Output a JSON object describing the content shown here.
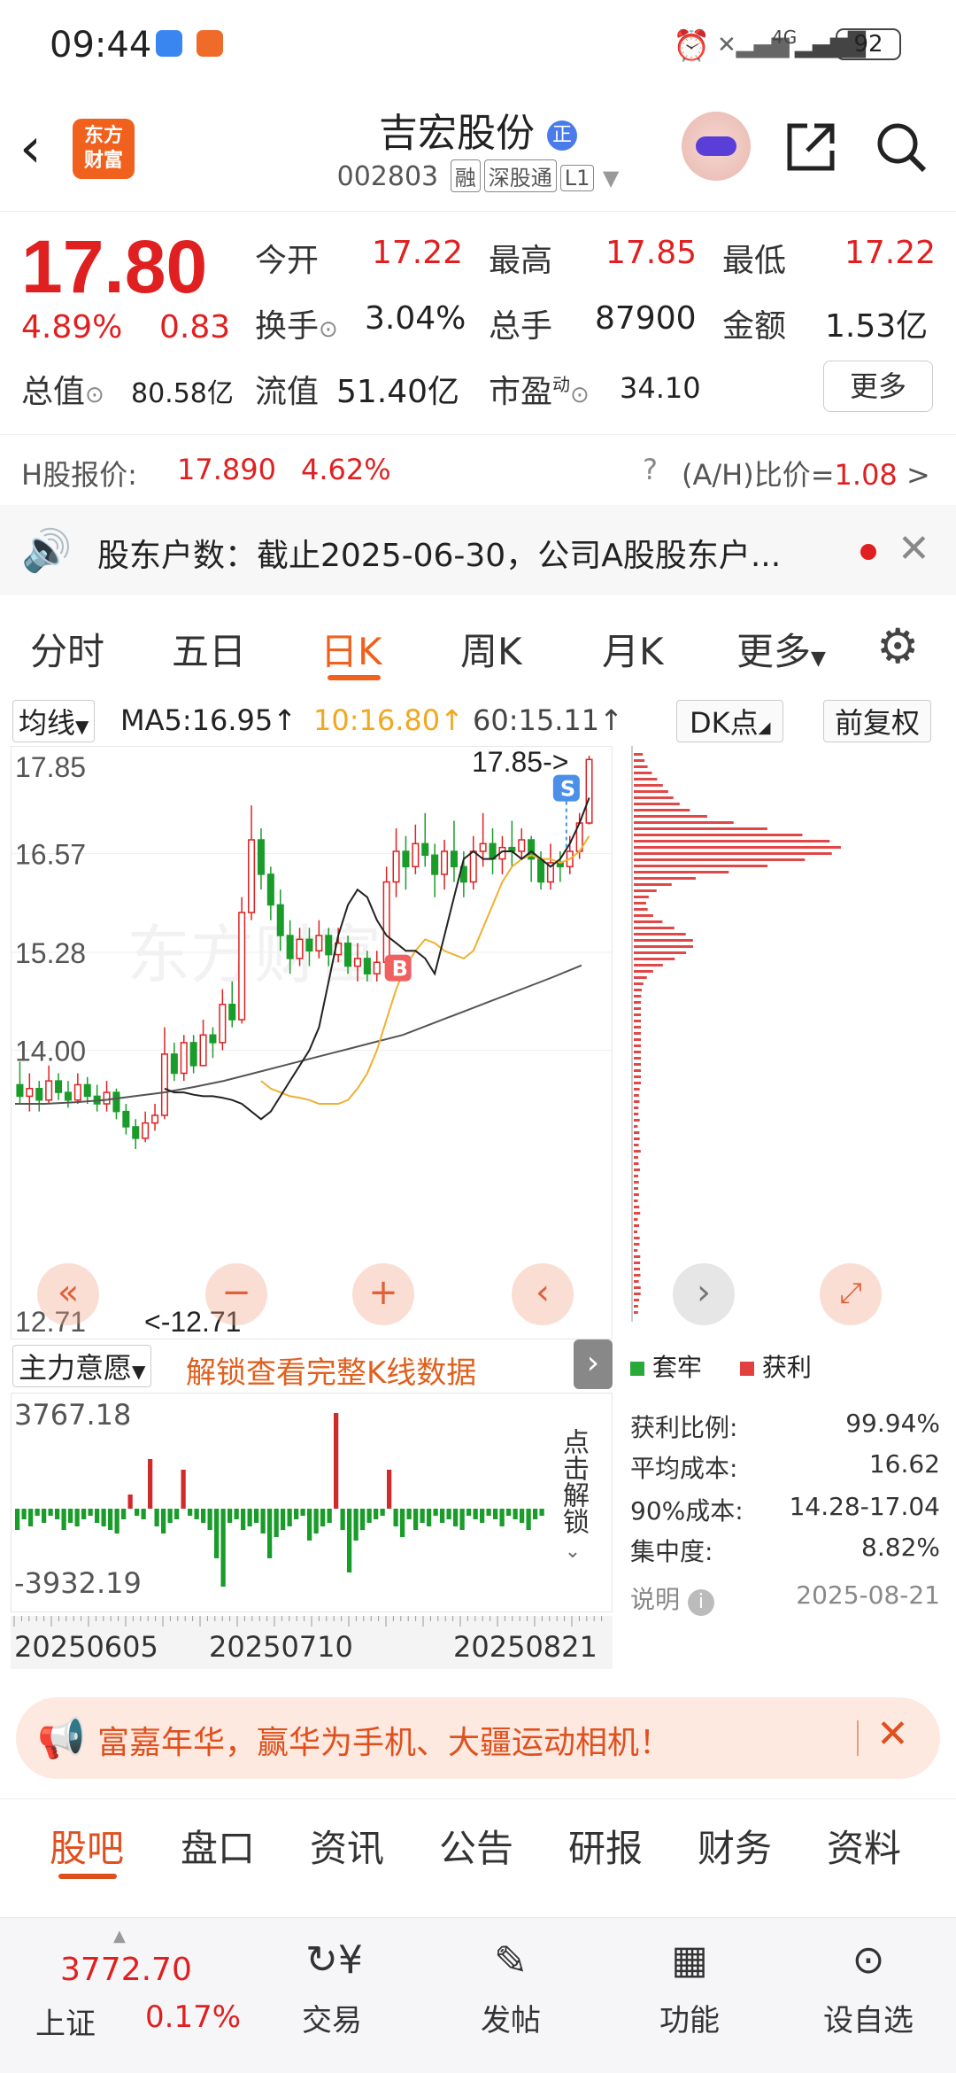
{
  "status_bar": {
    "time": "09:44",
    "signal_label": "4G",
    "battery": "92"
  },
  "header": {
    "logo_line1": "东方",
    "logo_line2": "财富",
    "stock_name": "吉宏股份",
    "name_badge": "正",
    "stock_code": "002803",
    "tags": [
      "融",
      "深股通",
      "L1"
    ]
  },
  "quote": {
    "price": "17.80",
    "change_pct": "4.89%",
    "change": "0.83",
    "open_label": "今开",
    "open": "17.22",
    "high_label": "最高",
    "high": "17.85",
    "low_label": "最低",
    "low": "17.22",
    "turnover_label": "换手",
    "turnover": "3.04%",
    "volume_label": "总手",
    "volume": "87900",
    "amount_label": "金额",
    "amount": "1.53亿",
    "mktcap_label": "总值",
    "mktcap": "80.58亿",
    "float_label": "流值",
    "float": "51.40亿",
    "pe_label": "市盈",
    "pe_sup": "动",
    "pe": "34.10",
    "more": "更多"
  },
  "hshare": {
    "label": "H股报价:",
    "price": "17.890",
    "pct": "4.62%",
    "ratio_label": "(A/H)比价=",
    "ratio": "1.08",
    "arrow": ">"
  },
  "notice": {
    "text": "股东户数：截止2025-06-30，公司A股股东户..."
  },
  "tabs": [
    "分时",
    "五日",
    "日K",
    "周K",
    "月K",
    "更多"
  ],
  "active_tab": "日K",
  "ma": {
    "selector": "均线",
    "ma5": "MA5:16.95↑",
    "ma10": "10:16.80↑",
    "ma60": "60:15.11↑",
    "dk": "DK点",
    "adj": "前复权"
  },
  "chart_data": {
    "type": "candlestick",
    "y_ticks": [
      "17.85",
      "16.57",
      "15.28",
      "14.00",
      "12.71"
    ],
    "ylim": [
      12.71,
      17.85
    ],
    "high_label": "17.85->",
    "low_label": "<-12.71",
    "buy_marker": "B",
    "sell_marker": "S",
    "watermark": "东方财富",
    "candles": [
      [
        13.55,
        13.4,
        13.85,
        13.3
      ],
      [
        13.4,
        13.5,
        13.7,
        13.2
      ],
      [
        13.5,
        13.35,
        13.6,
        13.2
      ],
      [
        13.35,
        13.6,
        13.8,
        13.3
      ],
      [
        13.6,
        13.45,
        13.7,
        13.35
      ],
      [
        13.45,
        13.35,
        13.6,
        13.25
      ],
      [
        13.35,
        13.55,
        13.7,
        13.3
      ],
      [
        13.55,
        13.4,
        13.65,
        13.3
      ],
      [
        13.4,
        13.3,
        13.55,
        13.2
      ],
      [
        13.3,
        13.45,
        13.6,
        13.2
      ],
      [
        13.45,
        13.2,
        13.5,
        13.1
      ],
      [
        13.2,
        13.0,
        13.3,
        12.9
      ],
      [
        13.0,
        12.85,
        13.1,
        12.71
      ],
      [
        12.85,
        13.05,
        13.2,
        12.8
      ],
      [
        13.05,
        13.15,
        13.3,
        12.95
      ],
      [
        13.15,
        13.95,
        14.3,
        13.1
      ],
      [
        13.95,
        13.7,
        14.1,
        13.6
      ],
      [
        13.7,
        14.1,
        14.2,
        13.6
      ],
      [
        14.1,
        13.8,
        14.2,
        13.7
      ],
      [
        13.8,
        14.2,
        14.4,
        13.8
      ],
      [
        14.2,
        14.1,
        14.3,
        13.9
      ],
      [
        14.1,
        14.6,
        14.8,
        14.0
      ],
      [
        14.6,
        14.4,
        14.9,
        14.3
      ],
      [
        14.4,
        15.8,
        16.0,
        14.35
      ],
      [
        15.8,
        16.75,
        17.2,
        15.7
      ],
      [
        16.75,
        16.3,
        16.9,
        16.1
      ],
      [
        16.3,
        15.9,
        16.4,
        15.7
      ],
      [
        15.9,
        15.5,
        16.1,
        15.3
      ],
      [
        15.5,
        15.2,
        15.7,
        15.0
      ],
      [
        15.2,
        15.45,
        15.6,
        15.1
      ],
      [
        15.45,
        15.3,
        15.6,
        15.1
      ],
      [
        15.3,
        15.5,
        15.7,
        15.2
      ],
      [
        15.5,
        15.25,
        15.6,
        15.1
      ],
      [
        15.25,
        15.4,
        15.6,
        15.15
      ],
      [
        15.4,
        15.1,
        15.5,
        15.0
      ],
      [
        15.1,
        15.2,
        15.4,
        14.9
      ],
      [
        15.2,
        15.0,
        15.3,
        14.9
      ],
      [
        15.0,
        15.15,
        15.3,
        14.9
      ],
      [
        15.15,
        16.2,
        16.4,
        15.1
      ],
      [
        16.2,
        16.6,
        16.9,
        16.0
      ],
      [
        16.6,
        16.4,
        16.8,
        16.1
      ],
      [
        16.4,
        16.7,
        16.95,
        16.3
      ],
      [
        16.7,
        16.55,
        17.1,
        16.4
      ],
      [
        16.55,
        16.3,
        16.7,
        16.0
      ],
      [
        16.3,
        16.6,
        16.75,
        16.1
      ],
      [
        16.6,
        16.4,
        17.0,
        16.2
      ],
      [
        16.4,
        16.2,
        16.6,
        16.0
      ],
      [
        16.2,
        16.6,
        16.8,
        16.1
      ],
      [
        16.6,
        16.7,
        17.1,
        16.4
      ],
      [
        16.7,
        16.5,
        16.9,
        16.3
      ],
      [
        16.5,
        16.65,
        16.8,
        16.3
      ],
      [
        16.65,
        16.6,
        17.0,
        16.4
      ],
      [
        16.6,
        16.75,
        16.9,
        16.5
      ],
      [
        16.75,
        16.5,
        16.8,
        16.2
      ],
      [
        16.5,
        16.2,
        16.6,
        16.1
      ],
      [
        16.2,
        16.45,
        16.7,
        16.1
      ],
      [
        16.45,
        16.4,
        16.6,
        16.2
      ],
      [
        16.4,
        16.6,
        16.8,
        16.3
      ],
      [
        16.6,
        16.97,
        17.1,
        16.5
      ],
      [
        16.97,
        17.8,
        17.85,
        16.95
      ]
    ],
    "ma5": [
      13.5,
      13.45,
      13.45,
      13.42,
      13.4,
      13.4,
      13.38,
      13.35,
      13.3,
      13.2,
      13.1,
      13.2,
      13.4,
      13.6,
      13.8,
      14.0,
      14.3,
      14.9,
      15.5,
      15.9,
      16.1,
      16.0,
      15.7,
      15.5,
      15.4,
      15.3,
      15.3,
      15.2,
      15.0,
      15.5,
      16.0,
      16.5,
      16.6,
      16.5,
      16.5,
      16.6,
      16.6,
      16.5,
      16.6,
      16.5,
      16.4,
      16.5,
      16.7,
      16.97,
      17.3
    ],
    "ma10": [
      13.6,
      13.5,
      13.45,
      13.4,
      13.38,
      13.35,
      13.3,
      13.3,
      13.3,
      13.35,
      13.5,
      13.7,
      14.0,
      14.4,
      14.8,
      15.1,
      15.3,
      15.45,
      15.4,
      15.3,
      15.25,
      15.2,
      15.3,
      15.6,
      15.9,
      16.2,
      16.4,
      16.5,
      16.55,
      16.5,
      16.5,
      16.45,
      16.5,
      16.6,
      16.8
    ],
    "ma60": [
      13.3,
      13.3,
      13.32,
      13.35,
      13.4,
      13.45,
      13.52,
      13.6,
      13.7,
      13.8,
      13.9,
      14.0,
      14.1,
      14.2,
      14.35,
      14.5,
      14.65,
      14.8,
      14.95,
      15.11
    ]
  },
  "distribution": {
    "legend_trapped": "套牢",
    "legend_profit": "获利"
  },
  "indicator": {
    "name": "主力意愿",
    "unlock_text": "解锁查看完整K线数据",
    "max": "3767.18",
    "min": "-3932.19",
    "side_text": "点击解锁"
  },
  "volume_bars": [
    -6,
    -3,
    -5,
    -2,
    -4,
    -2,
    -3,
    -6,
    -4,
    -5,
    -3,
    -2,
    -4,
    -5,
    -6,
    -7,
    -3,
    4,
    -2,
    -3,
    14,
    -5,
    -7,
    -4,
    -3,
    11,
    -2,
    -3,
    -4,
    -6,
    -14,
    -22,
    -4,
    -3,
    -6,
    -5,
    -4,
    -7,
    -14,
    -8,
    -6,
    -5,
    -3,
    -2,
    -9,
    -7,
    -5,
    -4,
    27,
    -6,
    -18,
    -9,
    -6,
    -4,
    -3,
    -2,
    11,
    -5,
    -8,
    -3,
    -6,
    -4,
    -5,
    -2,
    -4,
    -3,
    -5,
    -6,
    -2,
    -3,
    -4,
    -2,
    -3,
    -5,
    -2,
    -3,
    -4,
    -6,
    -3,
    -2
  ],
  "dates": [
    "20250605",
    "20250710",
    "20250821"
  ],
  "cost": {
    "profit_ratio_label": "获利比例:",
    "profit_ratio": "99.94%",
    "avg_cost_label": "平均成本:",
    "avg_cost": "16.62",
    "cost90_label": "90%成本:",
    "cost90": "14.28-17.04",
    "concentration_label": "集中度:",
    "concentration": "8.82%",
    "note_label": "说明",
    "date": "2025-08-21"
  },
  "banner": {
    "text": "富嘉年华，赢华为手机、大疆运动相机！"
  },
  "bottom_tabs": [
    "股吧",
    "盘口",
    "资讯",
    "公告",
    "研报",
    "财务",
    "资料"
  ],
  "navbar": {
    "index_price": "3772.70",
    "index_name": "上证",
    "index_pct": "0.17%",
    "items": [
      "交易",
      "发帖",
      "功能",
      "设自选"
    ]
  }
}
